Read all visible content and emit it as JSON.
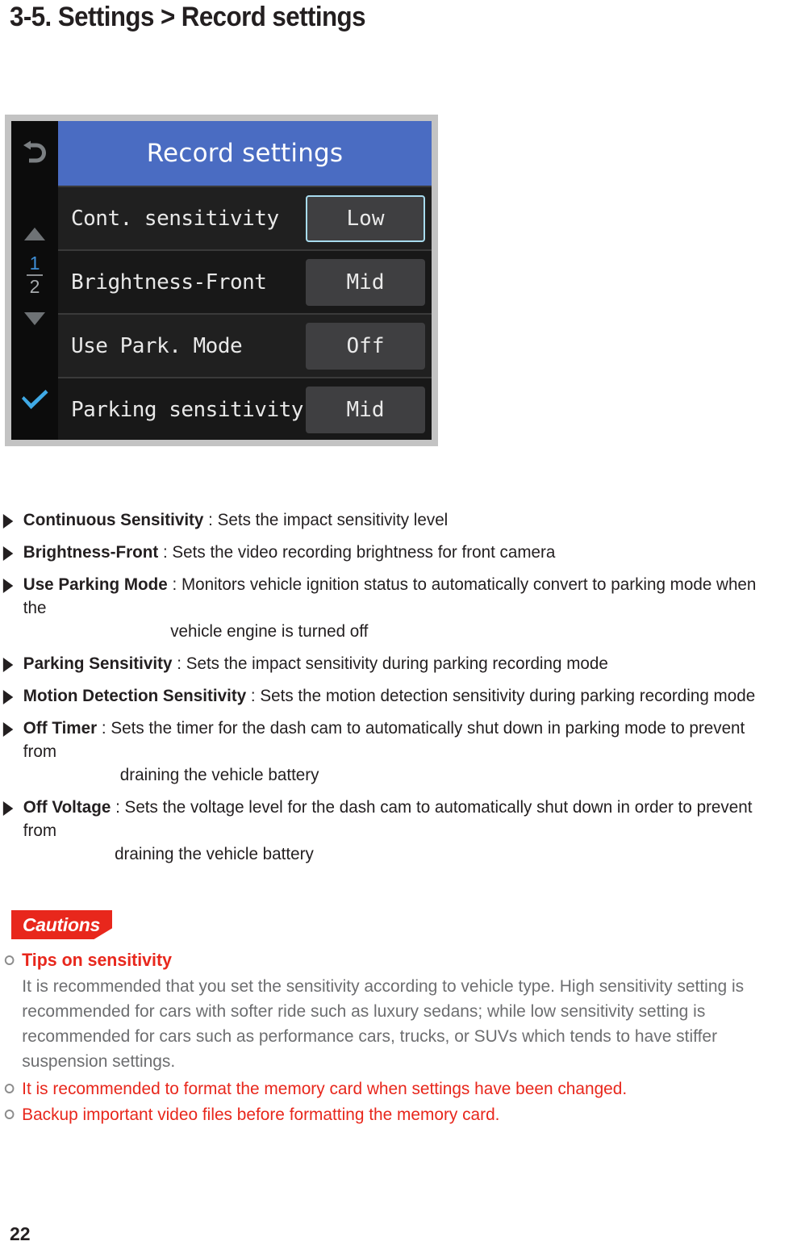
{
  "page": {
    "title": "3-5. Settings > Record settings",
    "number": "22"
  },
  "device_screen": {
    "header_title": "Record settings",
    "sidebar": {
      "back_icon": "back-arrow-icon",
      "up_icon": "scroll-up-triangle-icon",
      "page_current": "1",
      "page_total": "2",
      "down_icon": "scroll-down-triangle-icon",
      "confirm_icon": "checkmark-icon"
    },
    "rows": [
      {
        "label": "Cont. sensitivity",
        "value": "Low",
        "selected": true
      },
      {
        "label": "Brightness-Front",
        "value": "Mid",
        "selected": false
      },
      {
        "label": "Use Park. Mode",
        "value": "Off",
        "selected": false
      },
      {
        "label": "Parking sensitivity",
        "value": "Mid",
        "selected": false
      }
    ],
    "colors": {
      "header_blue": "#4a6cc2",
      "selected_border": "#a8dcef",
      "frame_gray": "#c3c3c3"
    }
  },
  "descriptions": [
    {
      "term": "Continuous Sensitivity",
      "body": " : Sets the impact sensitivity level",
      "cont": ""
    },
    {
      "term": "Brightness-Front",
      "body": " : Sets the video recording brightness for front camera",
      "cont": ""
    },
    {
      "term": "Use Parking Mode",
      "body": " : Monitors vehicle ignition status to automatically convert to parking mode when the",
      "cont": "vehicle engine is turned off"
    },
    {
      "term": "Parking Sensitivity",
      "body": " : Sets the impact sensitivity during parking recording mode",
      "cont": ""
    },
    {
      "term": "Motion Detection Sensitivity",
      "body": " : Sets the motion detection sensitivity during parking recording mode",
      "cont": ""
    },
    {
      "term": "Off Timer",
      "body": " : Sets the timer for the dash cam to automatically shut down in parking mode to prevent from",
      "cont": "draining the vehicle battery"
    },
    {
      "term": "Off Voltage",
      "body": " : Sets the voltage level for the dash cam to automatically shut down in order to prevent from",
      "cont": "draining the vehicle battery"
    }
  ],
  "cautions": {
    "badge_label": "Cautions",
    "badge_color": "#e8271c",
    "tips_heading": "Tips on sensitivity",
    "tips_paragraph": "It is recommended that you set the sensitivity according to vehicle type.  High sensitivity setting is recommended for cars with softer ride such as luxury sedans; while low sensitivity setting is recommended for cars such as performance cars, trucks, or SUVs which tends to have stiffer suspension settings.",
    "note1": "It is recommended to format the memory card when settings have been changed.",
    "note2": "Backup important video files before formatting the memory card."
  }
}
